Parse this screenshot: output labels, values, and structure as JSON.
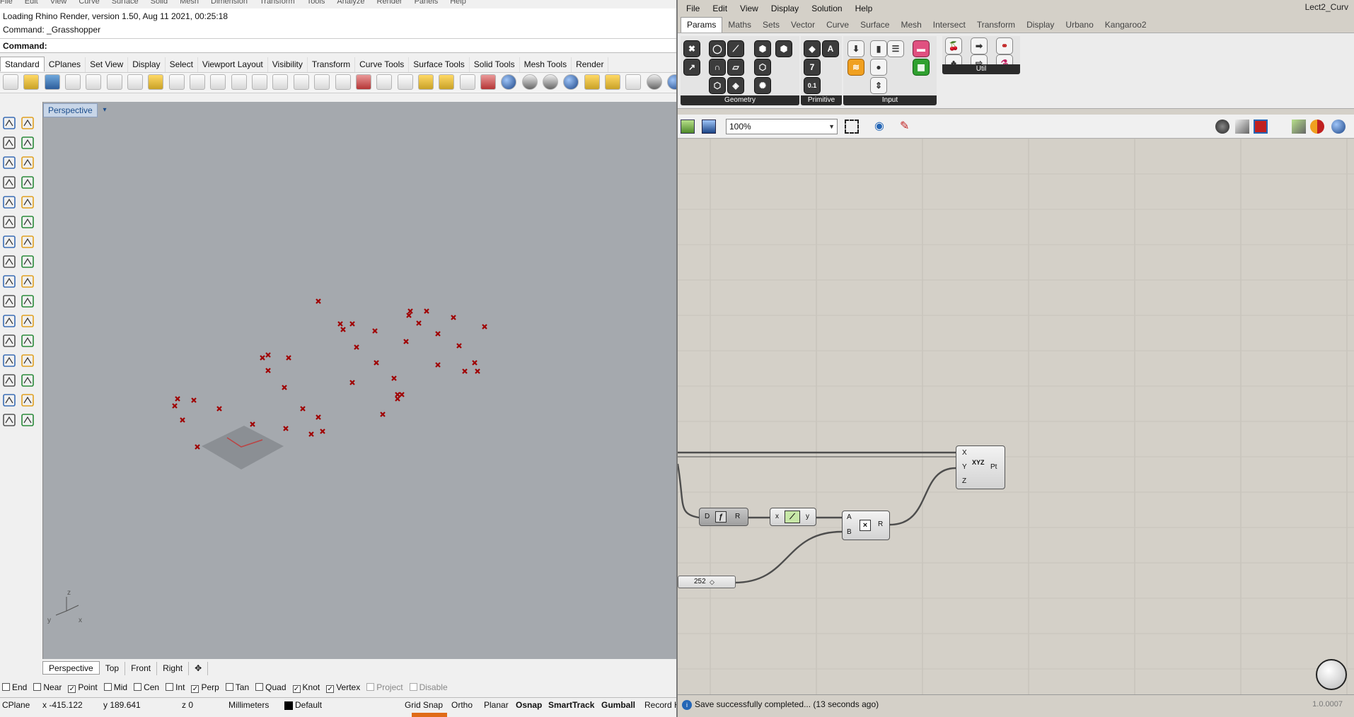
{
  "rhino": {
    "menubar": [
      "File",
      "Edit",
      "View",
      "Curve",
      "Surface",
      "Solid",
      "Mesh",
      "Dimension",
      "Transform",
      "Tools",
      "Analyze",
      "Render",
      "Panels",
      "Help"
    ],
    "history": [
      "Loading Rhino Render, version 1.50, Aug 11 2021, 00:25:18",
      "Command: _Grasshopper"
    ],
    "command_label": "Command:",
    "toolbar_tabs": [
      {
        "label": "Standard",
        "active": true
      },
      {
        "label": "CPlanes"
      },
      {
        "label": "Set View"
      },
      {
        "label": "Display"
      },
      {
        "label": "Select"
      },
      {
        "label": "Viewport Layout"
      },
      {
        "label": "Visibility"
      },
      {
        "label": "Transform"
      },
      {
        "label": "Curve Tools"
      },
      {
        "label": "Surface Tools"
      },
      {
        "label": "Solid Tools"
      },
      {
        "label": "Mesh Tools"
      },
      {
        "label": "Render"
      }
    ],
    "viewport": {
      "label": "Perspective",
      "menu_arrow": "▾",
      "bg": "#a5a9ae",
      "point_color": "#a00000",
      "axes": {
        "z": "z",
        "y": "y",
        "x": "x"
      }
    },
    "viewport_tabs": [
      {
        "label": "Perspective",
        "active": true
      },
      {
        "label": "Top"
      },
      {
        "label": "Front"
      },
      {
        "label": "Right"
      },
      {
        "label": "✥"
      }
    ],
    "osnaps": [
      {
        "label": "End",
        "checked": false
      },
      {
        "label": "Near",
        "checked": false
      },
      {
        "label": "Point",
        "checked": true
      },
      {
        "label": "Mid",
        "checked": false
      },
      {
        "label": "Cen",
        "checked": false
      },
      {
        "label": "Int",
        "checked": false
      },
      {
        "label": "Perp",
        "checked": true
      },
      {
        "label": "Tan",
        "checked": false
      },
      {
        "label": "Quad",
        "checked": false
      },
      {
        "label": "Knot",
        "checked": true
      },
      {
        "label": "Vertex",
        "checked": true
      },
      {
        "label": "Project",
        "checked": false,
        "dim": true
      },
      {
        "label": "Disable",
        "checked": false,
        "dim": true
      }
    ],
    "status": {
      "cplane": "CPlane",
      "x": "x -415.122",
      "y": "y 189.641",
      "z": "z 0",
      "units": "Millimeters",
      "layer": "Default",
      "grid_snap": "Grid Snap",
      "ortho": "Ortho",
      "planar": "Planar",
      "osnap": "Osnap",
      "smarttrack": "SmartTrack",
      "gumball": "Gumball",
      "record": "Record H"
    }
  },
  "grasshopper": {
    "window_title": "Lect2_Curv",
    "menubar": [
      "File",
      "Edit",
      "View",
      "Display",
      "Solution",
      "Help"
    ],
    "tabs": [
      {
        "label": "Params",
        "active": true
      },
      {
        "label": "Maths"
      },
      {
        "label": "Sets"
      },
      {
        "label": "Vector"
      },
      {
        "label": "Curve"
      },
      {
        "label": "Surface"
      },
      {
        "label": "Mesh"
      },
      {
        "label": "Intersect"
      },
      {
        "label": "Transform"
      },
      {
        "label": "Display"
      },
      {
        "label": "Urbano"
      },
      {
        "label": "Kangaroo2"
      }
    ],
    "panels": {
      "geometry": "Geometry",
      "primitive": "Primitive",
      "input": "Input",
      "util": "Util"
    },
    "primitive_glyphs": {
      "a": "A",
      "seven": "7",
      "decimal": "0.1"
    },
    "zoom": "100%",
    "components": {
      "construct_point": {
        "x": "X",
        "y": "Y",
        "z": "Z",
        "out": "Pt",
        "glyph": "XYZ"
      },
      "divide": {
        "in": "D",
        "out": "R"
      },
      "graph": {
        "in": "x",
        "out": "y"
      },
      "multiply": {
        "a": "A",
        "b": "B",
        "out": "R",
        "glyph": "×"
      }
    },
    "slider": {
      "value": "252"
    },
    "status": {
      "message": "Save successfully completed... (13 seconds ago)",
      "version": "1.0.0007"
    }
  }
}
